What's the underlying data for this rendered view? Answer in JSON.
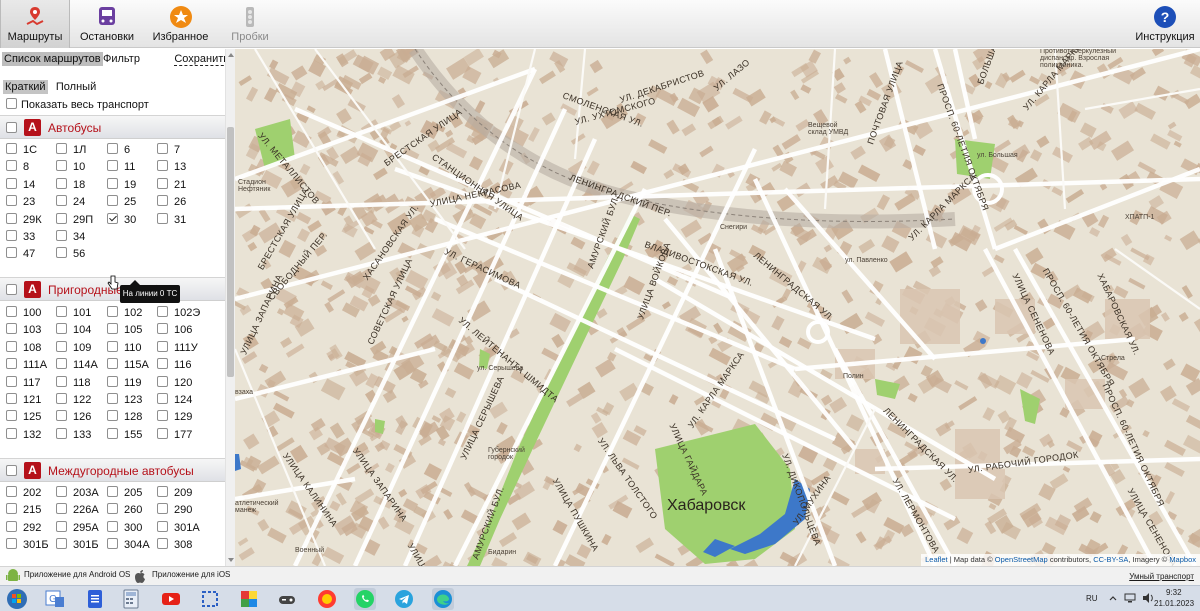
{
  "toolbar": {
    "routes": "Маршруты",
    "stops": "Остановки",
    "favorites": "Избранное",
    "traffic": "Пробки",
    "help": "Инструкция"
  },
  "sidebar": {
    "tabs": {
      "list": "Список маршрутов",
      "filter": "Фильтр",
      "save": "Сохранить"
    },
    "view": {
      "short": "Краткий",
      "full": "Полный"
    },
    "show_all": "Показать весь транспорт",
    "tooltip": "На линии 0 ТС",
    "categories": [
      {
        "badge": "А",
        "title": "Автобусы",
        "routes": [
          "1С",
          "1Л",
          "6",
          "7",
          "8",
          "10",
          "11",
          "13",
          "14",
          "18",
          "19",
          "21",
          "23",
          "24",
          "25",
          "26",
          "29К",
          "29П",
          "30",
          "31",
          "33",
          "34",
          "",
          "",
          "47",
          "56"
        ],
        "checked": [
          "30"
        ]
      },
      {
        "badge": "А",
        "title": "Пригородные автобусы",
        "routes": [
          "100",
          "101",
          "102",
          "102Э",
          "103",
          "104",
          "105",
          "106",
          "108",
          "109",
          "110",
          "111У",
          "111А",
          "114А",
          "115А",
          "116",
          "117",
          "118",
          "119",
          "120",
          "121",
          "122",
          "123",
          "124",
          "125",
          "126",
          "128",
          "129",
          "132",
          "133",
          "155",
          "177"
        ]
      },
      {
        "badge": "А",
        "title": "Междугородные автобусы",
        "routes": [
          "202",
          "203А",
          "205",
          "209",
          "215",
          "226А",
          "260",
          "290",
          "292",
          "295А",
          "300",
          "301А",
          "301Б",
          "301Б",
          "304А",
          "308"
        ]
      }
    ]
  },
  "map": {
    "city": "Хабаровск",
    "labels": {
      "dekabristov": "УЛ. ДЕКАБРИСТОВ",
      "smolenskaya": "СМОЛЕНСКАЯ УЛ.",
      "lazo": "УЛ. ЛАЗО",
      "ukhtomskogo": "УЛ. УХТОМСКОГО",
      "metallistov": "УЛ. МЕТАЛЛИСТОВ",
      "brestskaya": "БРЕСТСКАЯ УЛИЦА",
      "stantsionnaya": "СТАНЦИОННАЯ УЛИЦА",
      "leningradsky": "ЛЕНИНГРАДСКИЙ ПЕР.",
      "nekrasova": "УЛИЦА НЕКРАСОВА",
      "gerasimova": "УЛ. ГЕРАСИМОВА",
      "amursky": "АМУРСКИЙ БУЛ.",
      "vladivostokskaya": "ВЛАДИВОСТОКСКАЯ УЛ.",
      "leningradskaya": "ЛЕНИНГРАДСКАЯ УЛ.",
      "leytenanta": "УЛ. ЛЕЙТЕНАНТА ШМИДТА",
      "sovetskaya": "СОВЕТСКАЯ УЛИЦА",
      "khasanovskaya": "ХАСАНОВСКАЯ УЛ.",
      "brestskaya2": "БРЕСТСКАЯ УЛИЦА",
      "svobodny": "СВОБОДНЫЙ ПЕР.",
      "zaparina": "УЛИЦА ЗАПАРИНА",
      "zaparina2": "УЛИЦА ЗАПАРИНА",
      "kalinina": "УЛИЦА КАЛИНИНА",
      "serysheva": "УЛИЦА СЕРЫШЕВА",
      "pushkina": "УЛИЦА ПУШКИНА",
      "lva_tolstogo": "УЛ. ЛЬВА ТОЛСТОГО",
      "gaydara": "УЛИЦА ГАЙДАРА",
      "karla_marksa": "УЛ. КАРЛА МАРКСА",
      "dikopoltseva": "УЛ. ДИКОПОЛЬЦЕВА",
      "leningradskaya2": "ЛЕНИНГРАДСКАЯ УЛ.",
      "rabochy": "УЛ. РАБОЧИЙ ГОРОДОК",
      "lermontova": "УЛ. ЛЕРМОНТОВА",
      "mukhina": "УЛ. МУХИНА",
      "frunze": "УЛИЦА ФРУНЗЕ",
      "amursky2": "АМУРСКИЙ БУЛ.",
      "karla_marksa2": "УЛ. КАРЛА МАРКСА",
      "karla_marksa3": "УЛ. КАРЛА МАРКСА",
      "oktyabrya": "ПРОСП. 60-ЛЕТИЯ ОКТЯБРЯ",
      "oktyabrya2": "ПРОСП. 60-ЛЕТИЯ ОКТЯБРЯ",
      "oktyabrya3": "ПРОСП. 60-ЛЕТИЯ ОКТЯБРЯ",
      "bolshaya": "БОЛЬШАЯ УЛИЦА",
      "semenova": "УЛИЦА СЕНЕНОВА",
      "semenova2": "УЛИЦА СЕНЕНОВА",
      "pochtovaya": "ПОЧТОВАЯ УЛИЦА",
      "khabarovskaya": "ХАБАРОВСКАЯ УЛ.",
      "voykova": "УЛИЦА ВОЙКОВА",
      "bolshaya_sm": "ул. Большая",
      "pavlenko": "ул. Павленко",
      "serysheva_sm": "ул. Серышева",
      "stadion": "Стадион\nНефтяник",
      "veshevoy": "Вещевой\nсклад УМВД",
      "dispanser": "Противотуберкулезный\nдиспансер. Взрослая\nполиклиника.",
      "snegiri": "Снегири",
      "polin": "Полин",
      "strela": "Стрела",
      "khatp": "ХПАТП-1",
      "gubernsky": "Губернский\nгородок",
      "sportmanezh": "атлетический\nманеж",
      "voenny": "Военный",
      "bdarin": "Бидарин",
      "zakha": "взаха"
    },
    "attribution": {
      "leaflet": "Leaflet",
      "data": "Map data ©",
      "osm": "OpenStreetMap",
      "contributors": "contributors,",
      "cc": "CC-BY-SA",
      "imagery": ", Imagery ©",
      "mapbox": "Mapbox"
    }
  },
  "footer": {
    "android": "Приложение для Android OS",
    "ios": "Приложение для iOS",
    "smart": "Умный транспорт"
  },
  "tray": {
    "lang": "RU",
    "time": "9:32",
    "date": "21.01.2023"
  },
  "colors": {
    "accent": "#b5111a",
    "park": "#9fd06f",
    "water": "#3d78c9",
    "land": "#e9e3d5",
    "building": "#c9ad93"
  }
}
